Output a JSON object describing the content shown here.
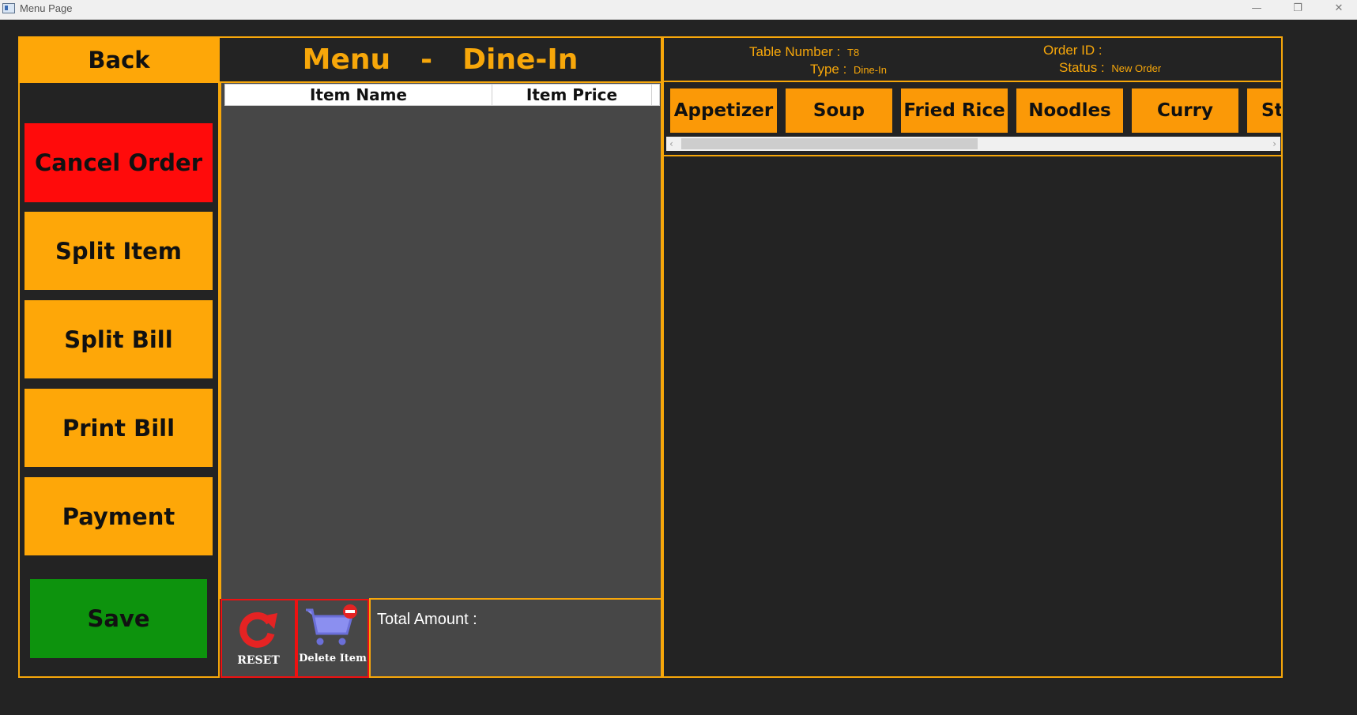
{
  "window": {
    "title": "Menu Page",
    "minimize": "—",
    "restore": "❐",
    "close": "✕"
  },
  "nav": {
    "back_label": "Back"
  },
  "actions": {
    "cancel_order": "Cancel Order",
    "split_item": "Split Item",
    "split_bill": "Split Bill",
    "print_bill": "Print Bill",
    "payment": "Payment",
    "save": "Save"
  },
  "header": {
    "menu": "Menu",
    "separator": "-",
    "order_type": "Dine-In"
  },
  "order_table": {
    "columns": [
      "Item Name",
      "Item Price"
    ],
    "rows": []
  },
  "tools": {
    "reset_label": "RESET",
    "delete_label": "Delete Item"
  },
  "totals": {
    "total_label": "Total Amount :",
    "total_value": ""
  },
  "order_info": {
    "table_label": "Table Number :",
    "table_value": "T8",
    "type_label": "Type :",
    "type_value": "Dine-In",
    "order_id_label": "Order ID :",
    "order_id_value": "",
    "status_label": "Status :",
    "status_value": "New Order"
  },
  "categories": [
    "Appetizer",
    "Soup",
    "Fried Rice",
    "Noodles",
    "Curry",
    "St"
  ],
  "colors": {
    "accent": "#f7a70a",
    "button": "#fea708",
    "cancel": "#ff0b0b",
    "save": "#0d930d",
    "panel": "#474747",
    "background": "#232323"
  }
}
